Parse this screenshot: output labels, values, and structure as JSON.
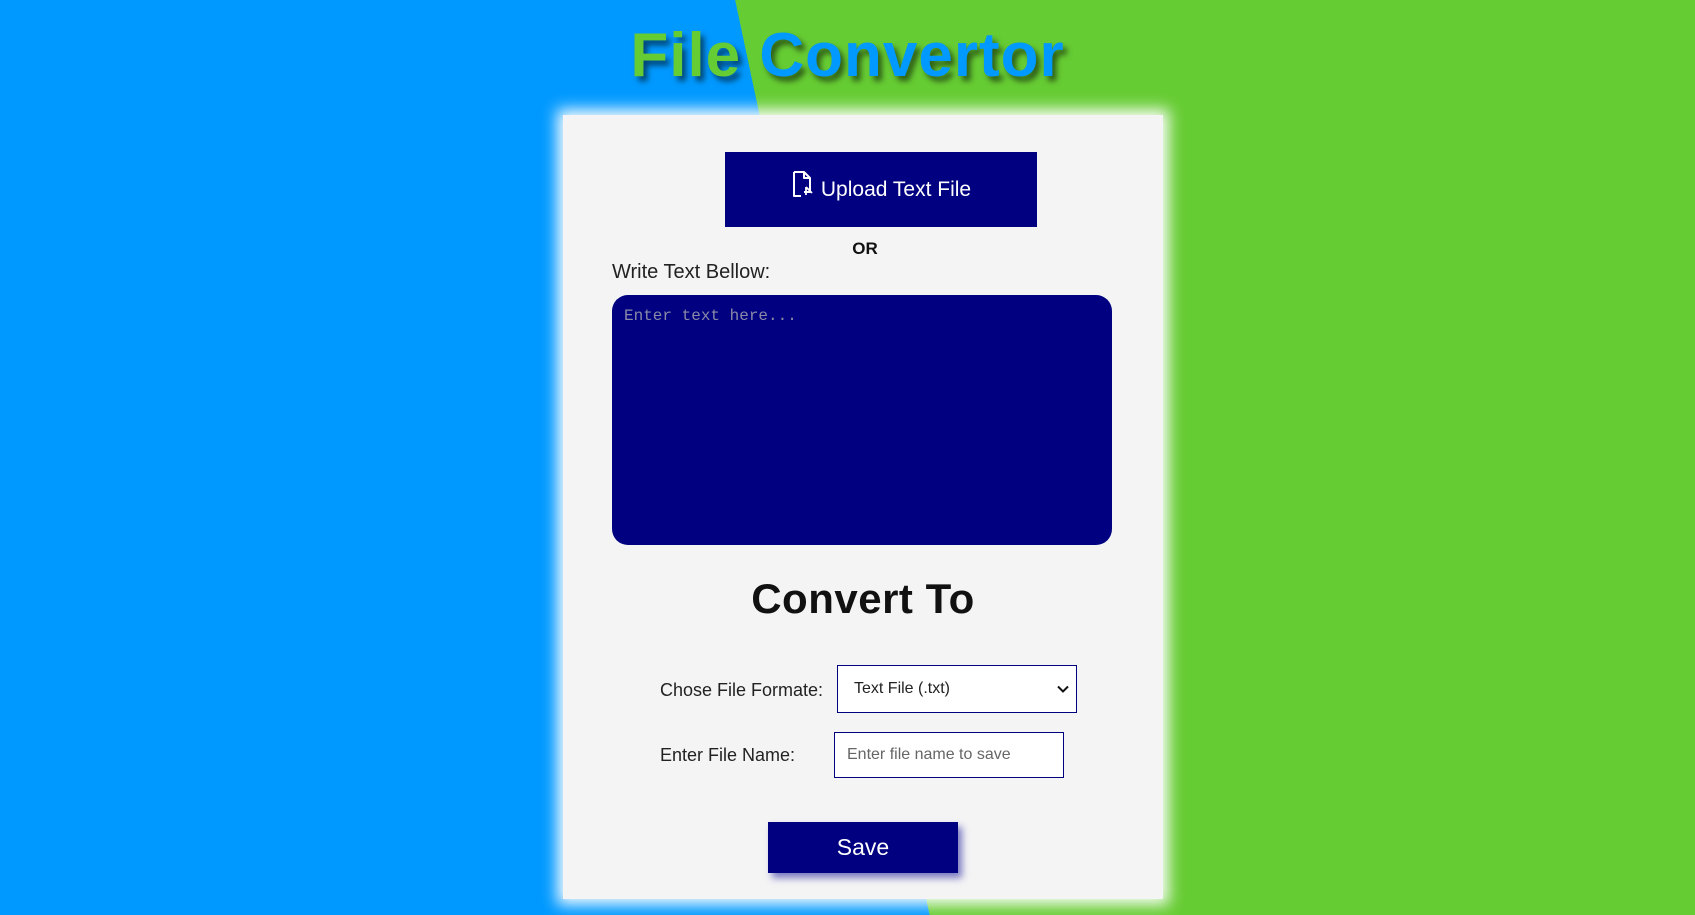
{
  "app": {
    "title_word1": "File",
    "title_word2": "Convertor",
    "title_color_word1": "#66cc33",
    "title_color_word2": "#0099ff"
  },
  "background": {
    "left_color": "#0099ff",
    "right_color": "#66cc33"
  },
  "upload": {
    "label": "Upload Text File",
    "icon": "file-upload-icon",
    "color": "#000080"
  },
  "divider": {
    "text": "OR"
  },
  "editor": {
    "label": "Write Text Bellow:",
    "placeholder": "Enter text here...",
    "value": ""
  },
  "convert": {
    "heading": "Convert To",
    "format_label": "Chose File Formate:",
    "format_selected": "Text File (.txt)",
    "name_label": "Enter File Name:",
    "name_placeholder": "Enter file name to save",
    "name_value": ""
  },
  "actions": {
    "save_label": "Save"
  }
}
